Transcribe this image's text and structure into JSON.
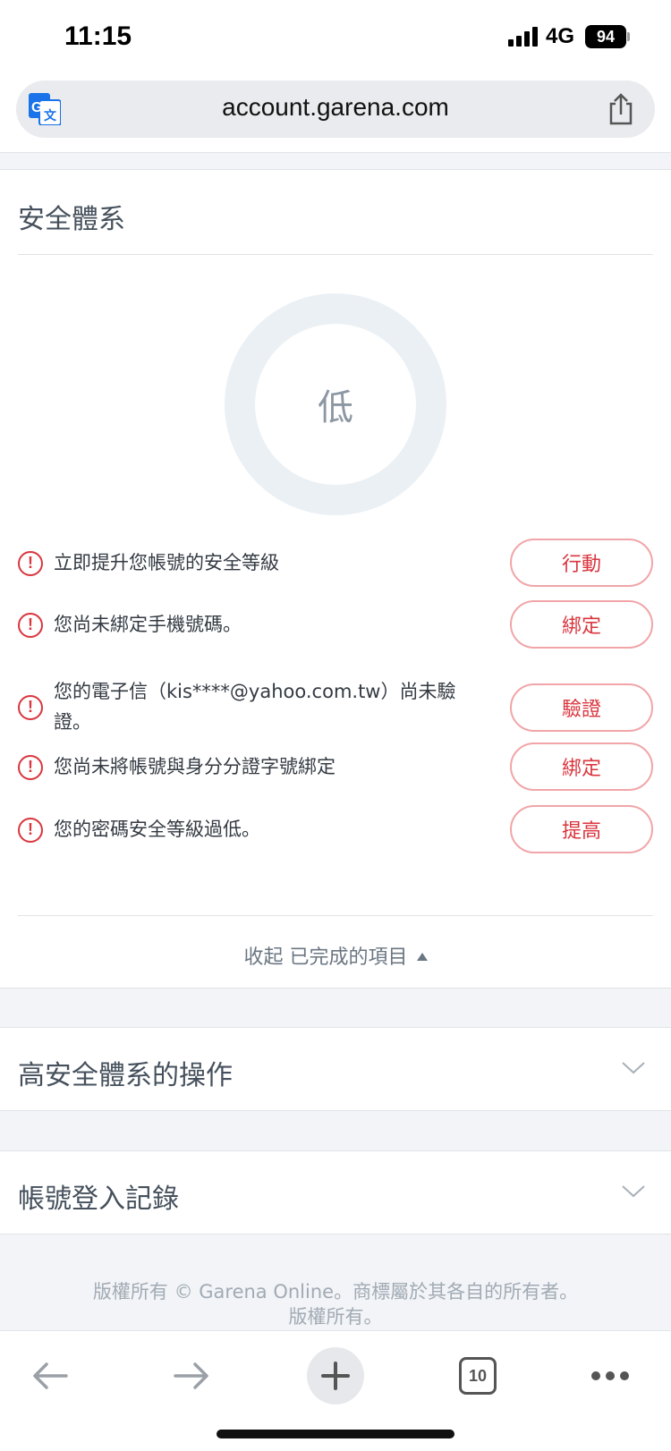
{
  "status_bar": {
    "time": "11:15",
    "network": "4G",
    "battery": "94"
  },
  "browser": {
    "url": "account.garena.com"
  },
  "security": {
    "title": "安全體系",
    "level": "低",
    "items": [
      {
        "text": "立即提升您帳號的安全等級",
        "action": "行動"
      },
      {
        "text": "您尚未綁定手機號碼。",
        "action": "綁定"
      },
      {
        "text": "您的電子信（kis****@yahoo.com.tw）尚未驗證。",
        "action": "驗證"
      },
      {
        "text": "您尚未將帳號與身分分證字號綁定",
        "action": "綁定"
      },
      {
        "text": "您的密碼安全等級過低。",
        "action": "提高"
      }
    ],
    "collapse_label": "收起 已完成的項目"
  },
  "accordions": [
    {
      "title": "高安全體系的操作"
    },
    {
      "title": "帳號登入記錄"
    }
  ],
  "footer": {
    "line1": "版權所有 © Garena Online。商標屬於其各自的所有者。",
    "line2": "版權所有。"
  },
  "toolbar": {
    "tab_count": "10"
  },
  "colors": {
    "accent_red": "#d9363e",
    "ring": "#eaf0f4",
    "text_muted": "#6b7682"
  }
}
